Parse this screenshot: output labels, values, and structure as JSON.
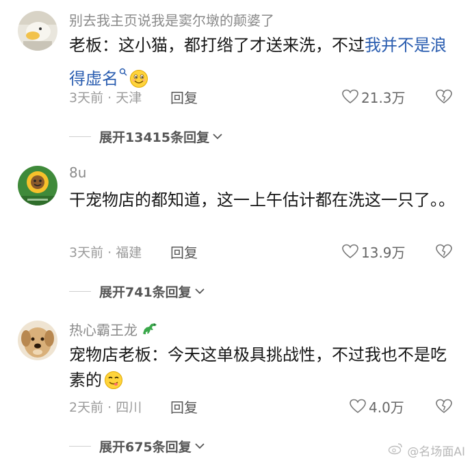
{
  "comments": [
    {
      "username": "别去我主页说我是窦尔墩的颠婆了",
      "text_before": "老板：这小猫，都打绺了才送来洗，不过",
      "text_link": "我并不是浪得虚名",
      "emoji": "smiling-face-emoji",
      "time_location": "3天前 · 天津",
      "reply_label": "回复",
      "likes": "21.3万",
      "expand_label": "展开13415条回复"
    },
    {
      "username": "8u",
      "text_before": "干宠物店的都知道，这一上午估计都在洗这一只了。。",
      "time_location": "3天前 · 福建",
      "reply_label": "回复",
      "likes": "13.9万",
      "expand_label": "展开741条回复"
    },
    {
      "username": "热心霸王龙",
      "username_emoji": "dinosaur-emoji",
      "text_before": "宠物店老板：今天这单极具挑战性，不过我也不是吃素的",
      "emoji": "yum-face-emoji",
      "time_location": "2天前 · 四川",
      "reply_label": "回复",
      "likes": "4.0万",
      "expand_label": "展开675条回复"
    }
  ],
  "watermark": "@名场面AI",
  "colors": {
    "link": "#2a5db0",
    "meta": "#9a9a9a",
    "text": "#161616"
  }
}
